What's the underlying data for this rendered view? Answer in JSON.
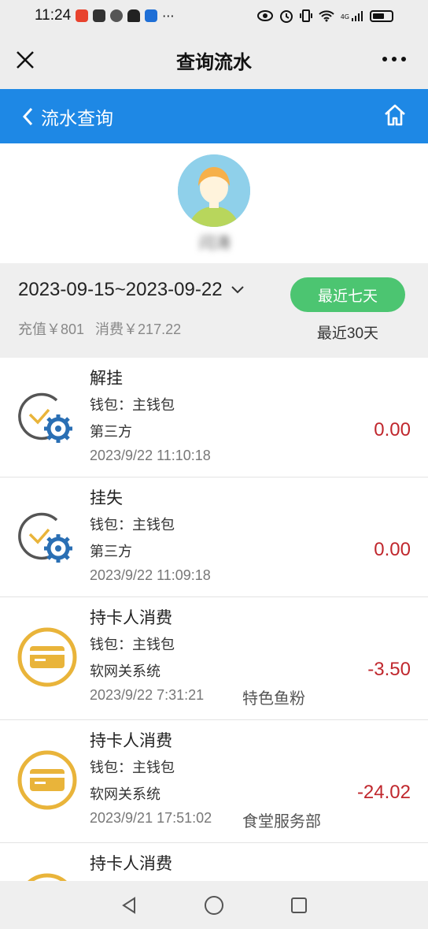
{
  "status_bar": {
    "time": "11:24",
    "dots": "···",
    "network": "4G"
  },
  "title_bar": {
    "title": "查询流水"
  },
  "header": {
    "back_label": "流水查询"
  },
  "profile": {
    "name": "闫涛"
  },
  "filter": {
    "date_range": "2023-09-15~2023-09-22",
    "recharge": "充值￥801",
    "spend": "消费￥217.22",
    "btn_7days": "最近七天",
    "btn_30days": "最近30天"
  },
  "transactions": [
    {
      "type": "解挂",
      "wallet": "钱包：主钱包",
      "source": "第三方",
      "time": "2023/9/22 11:10:18",
      "merchant": "",
      "amount": "0.00",
      "icon": "gear-check-icon"
    },
    {
      "type": "挂失",
      "wallet": "钱包：主钱包",
      "source": "第三方",
      "time": "2023/9/22 11:09:18",
      "merchant": "",
      "amount": "0.00",
      "icon": "gear-check-icon"
    },
    {
      "type": "持卡人消费",
      "wallet": "钱包：主钱包",
      "source": "软网关系统",
      "time": "2023/9/22 7:31:21",
      "merchant": "特色鱼粉",
      "amount": "-3.50",
      "icon": "card-icon"
    },
    {
      "type": "持卡人消费",
      "wallet": "钱包：主钱包",
      "source": "软网关系统",
      "time": "2023/9/21 17:51:02",
      "merchant": "食堂服务部",
      "amount": "-24.02",
      "icon": "card-icon"
    },
    {
      "type": "持卡人消费",
      "wallet": "",
      "source": "",
      "time": "",
      "merchant": "",
      "amount": "",
      "icon": "card-icon"
    }
  ],
  "colors": {
    "accent_blue": "#1e88e5",
    "green_button": "#4cc571",
    "amount_red": "#c0272d",
    "card_icon_yellow": "#e9b43a"
  }
}
